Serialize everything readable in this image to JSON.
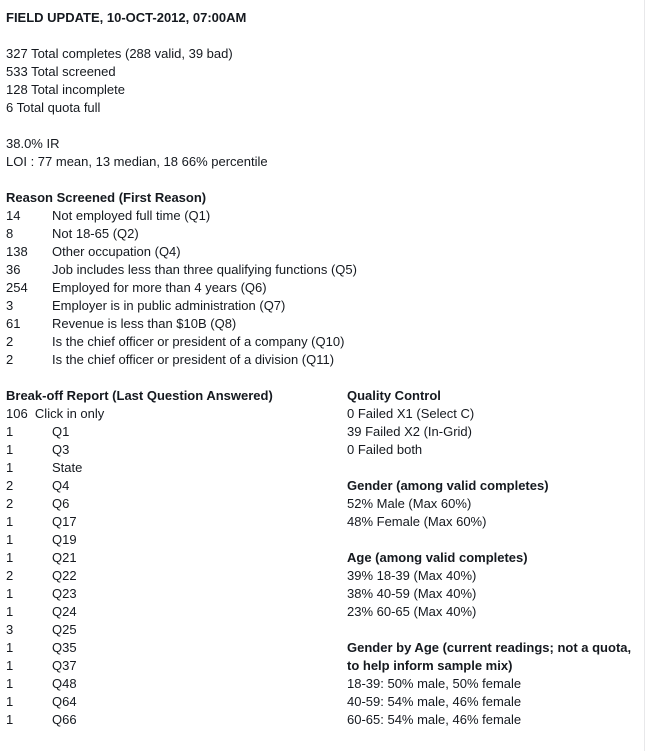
{
  "report": {
    "title": "FIELD UPDATE, 10-OCT-2012, 07:00AM",
    "summary": [
      "327 Total completes (288 valid, 39 bad)",
      "533 Total screened",
      "128 Total incomplete",
      "6 Total quota full"
    ],
    "metrics": [
      "38.0% IR",
      "LOI : 77 mean, 13 median, 18 66% percentile"
    ],
    "reason_screened": {
      "heading": "Reason Screened (First Reason)",
      "rows": [
        {
          "count": "14",
          "label": "Not employed full time (Q1)"
        },
        {
          "count": "8",
          "label": "Not 18-65 (Q2)"
        },
        {
          "count": "138",
          "label": "Other occupation (Q4)"
        },
        {
          "count": "36",
          "label": "Job includes less than three qualifying functions (Q5)"
        },
        {
          "count": "254",
          "label": "Employed for more than 4 years (Q6)"
        },
        {
          "count": "3",
          "label": "Employer is in public administration (Q7)"
        },
        {
          "count": "61",
          "label": "Revenue is less than $10B (Q8)"
        },
        {
          "count": "2",
          "label": "Is the chief officer or president of a company (Q10)"
        },
        {
          "count": "2",
          "label": "Is the chief officer or president of a division (Q11)"
        }
      ]
    },
    "breakoff": {
      "heading": "Break-off Report (Last Question Answered)",
      "first_row": "106  Click in only",
      "rows": [
        {
          "count": "1",
          "label": "Q1"
        },
        {
          "count": "1",
          "label": "Q3"
        },
        {
          "count": "1",
          "label": "State"
        },
        {
          "count": "2",
          "label": "Q4"
        },
        {
          "count": "2",
          "label": "Q6"
        },
        {
          "count": "1",
          "label": "Q17"
        },
        {
          "count": "1",
          "label": "Q19"
        },
        {
          "count": "1",
          "label": "Q21"
        },
        {
          "count": "2",
          "label": "Q22"
        },
        {
          "count": "1",
          "label": "Q23"
        },
        {
          "count": "1",
          "label": "Q24"
        },
        {
          "count": "3",
          "label": "Q25"
        },
        {
          "count": "1",
          "label": "Q35"
        },
        {
          "count": "1",
          "label": "Q37"
        },
        {
          "count": "1",
          "label": "Q48"
        },
        {
          "count": "1",
          "label": "Q64"
        },
        {
          "count": "1",
          "label": "Q66"
        }
      ]
    },
    "quality_control": {
      "heading": "Quality Control",
      "rows": [
        "0 Failed X1 (Select C)",
        "39 Failed X2 (In-Grid)",
        "0 Failed both"
      ]
    },
    "gender": {
      "heading": "Gender (among valid completes)",
      "rows": [
        "52% Male (Max 60%)",
        "48% Female (Max 60%)"
      ]
    },
    "age": {
      "heading": "Age (among valid completes)",
      "rows": [
        "39% 18-39 (Max 40%)",
        "38% 40-59 (Max 40%)",
        "23% 60-65 (Max 40%)"
      ]
    },
    "gender_by_age": {
      "heading": "Gender by Age (current readings; not a quota, to help inform sample mix)",
      "rows": [
        "18-39: 50% male, 50% female",
        "40-59: 54% male, 46% female",
        "60-65: 54% male, 46% female"
      ]
    }
  }
}
